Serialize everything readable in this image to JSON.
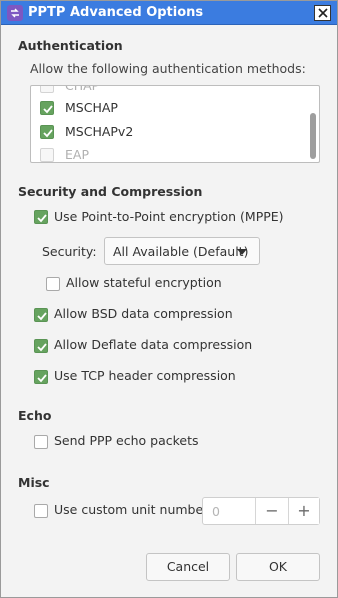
{
  "window": {
    "title": "PPTP Advanced Options",
    "icon": "app-icon",
    "close_icon": "close-icon"
  },
  "authentication": {
    "title": "Authentication",
    "subtitle": "Allow the following authentication methods:",
    "methods": [
      {
        "label": "CHAP",
        "checked": false,
        "disabled": true
      },
      {
        "label": "MSCHAP",
        "checked": true,
        "disabled": false
      },
      {
        "label": "MSCHAPv2",
        "checked": true,
        "disabled": false
      },
      {
        "label": "EAP",
        "checked": false,
        "disabled": true
      }
    ]
  },
  "security": {
    "title": "Security and Compression",
    "mppe": {
      "label": "Use Point-to-Point encryption (MPPE)",
      "checked": true
    },
    "security_label": "Security:",
    "security_value": "All Available (Default)",
    "stateful": {
      "label": "Allow stateful encryption",
      "checked": false
    },
    "bsd": {
      "label": "Allow BSD data compression",
      "checked": true
    },
    "deflate": {
      "label": "Allow Deflate data compression",
      "checked": true
    },
    "tcp": {
      "label": "Use TCP header compression",
      "checked": true
    }
  },
  "echo": {
    "title": "Echo",
    "send": {
      "label": "Send PPP echo packets",
      "checked": false
    }
  },
  "misc": {
    "title": "Misc",
    "unit": {
      "label": "Use custom unit number:",
      "checked": false
    },
    "unit_value": "0",
    "minus": "−",
    "plus": "+"
  },
  "buttons": {
    "cancel": "Cancel",
    "ok": "OK"
  },
  "colors": {
    "titlebar": "#3b7ce0",
    "check": "#66a35f"
  }
}
